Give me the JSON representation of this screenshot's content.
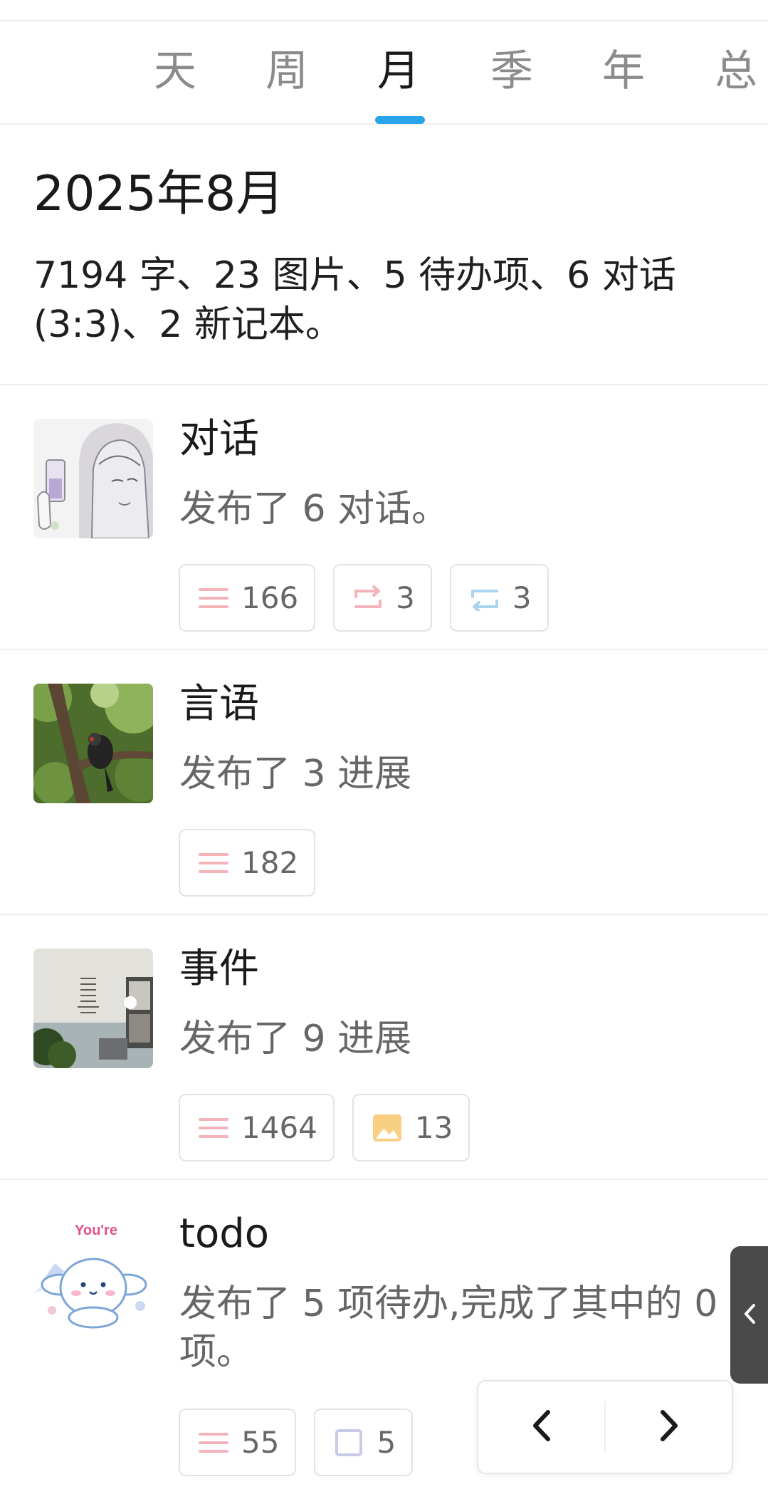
{
  "tabs": [
    {
      "label": "天"
    },
    {
      "label": "周"
    },
    {
      "label": "月"
    },
    {
      "label": "季"
    },
    {
      "label": "年"
    },
    {
      "label": "总"
    }
  ],
  "active_tab": "月",
  "summary": {
    "title": "2025年8月",
    "text": "7194 字、23 图片、5 待办项、6 对话(3:3)、2 新记本。"
  },
  "sections": [
    {
      "title": "对话",
      "desc": "发布了 6 对话。",
      "stats": [
        {
          "icon": "lines-icon",
          "value": "166"
        },
        {
          "icon": "repeat-out-icon",
          "value": "3"
        },
        {
          "icon": "repeat-in-icon",
          "value": "3"
        }
      ]
    },
    {
      "title": "言语",
      "desc": "发布了 3 进展",
      "stats": [
        {
          "icon": "lines-icon",
          "value": "182"
        }
      ]
    },
    {
      "title": "事件",
      "desc": "发布了 9 进展",
      "stats": [
        {
          "icon": "lines-icon",
          "value": "1464"
        },
        {
          "icon": "image-icon",
          "value": "13"
        }
      ]
    },
    {
      "title": "todo",
      "desc": "发布了 5 项待办,完成了其中的 0 项。",
      "thumb_text": "You're",
      "stats": [
        {
          "icon": "lines-icon",
          "value": "55"
        },
        {
          "icon": "checkbox-icon",
          "value": "5"
        }
      ]
    }
  ],
  "colors": {
    "accent": "#2aa3e8",
    "lines_icon": "#f4b3b8",
    "repeat_in_icon": "#a9d3f0",
    "image_icon": "#f8cf83",
    "checkbox_icon": "#c9c9e8",
    "side_tab": "#4a4a4a"
  }
}
